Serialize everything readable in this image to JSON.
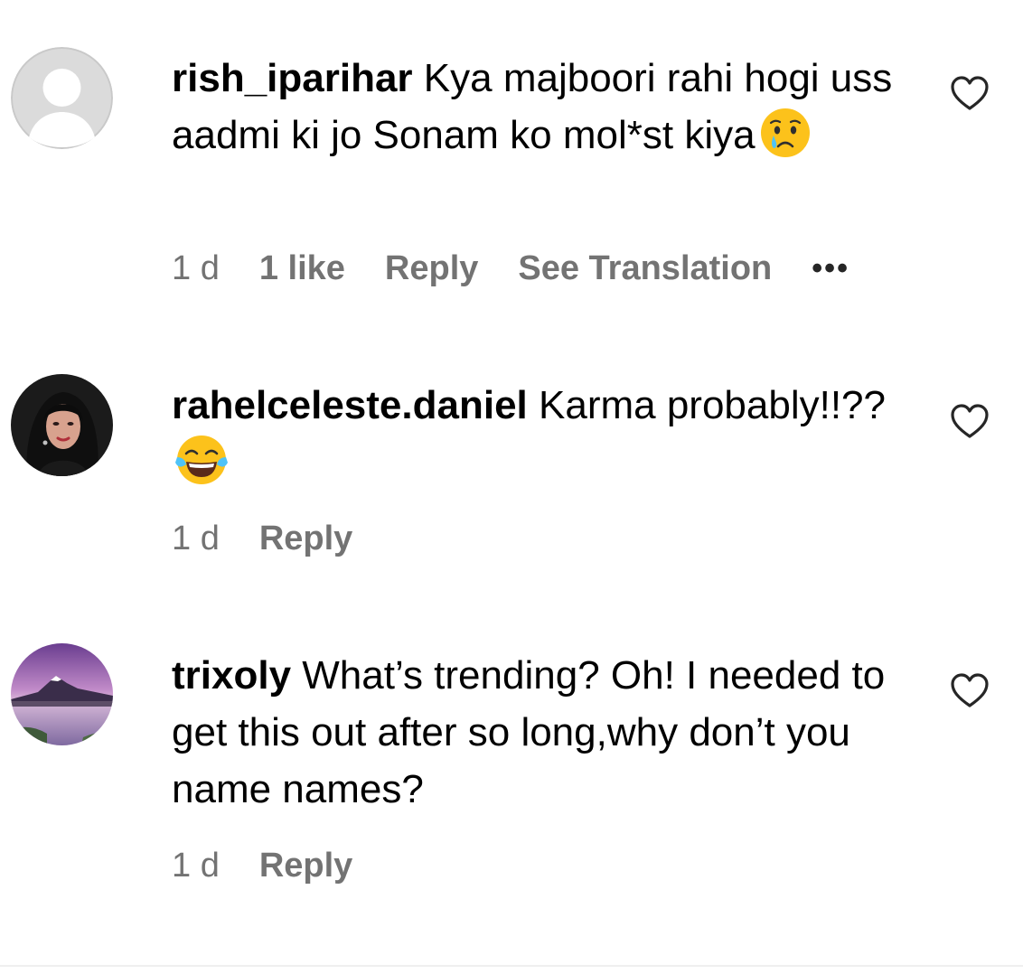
{
  "comments": [
    {
      "username": "rish_iparihar",
      "text": "Kya majboori rahi hogi uss aadmi ki jo Sonam ko mol*st kiya",
      "emoji": "crying-face-emoji",
      "time": "1 d",
      "likes": "1 like",
      "reply_label": "Reply",
      "translation_label": "See Translation",
      "more_label": "•••",
      "avatar": "default-profile-icon"
    },
    {
      "username": "rahelceleste.daniel",
      "text": "Karma probably!!??",
      "emoji": "face-with-tears-of-joy-emoji",
      "time": "1 d",
      "reply_label": "Reply",
      "avatar": "user-photo"
    },
    {
      "username": "trixoly",
      "text": "What’s trending? Oh! I needed to get this out after so long,why don’t you name names?",
      "time": "1 d",
      "reply_label": "Reply",
      "avatar": "mountain-lake-photo"
    }
  ],
  "colors": {
    "text": "#000000",
    "meta": "#737373",
    "avatar_default": "#dbdbdb",
    "divider": "#efefef"
  }
}
